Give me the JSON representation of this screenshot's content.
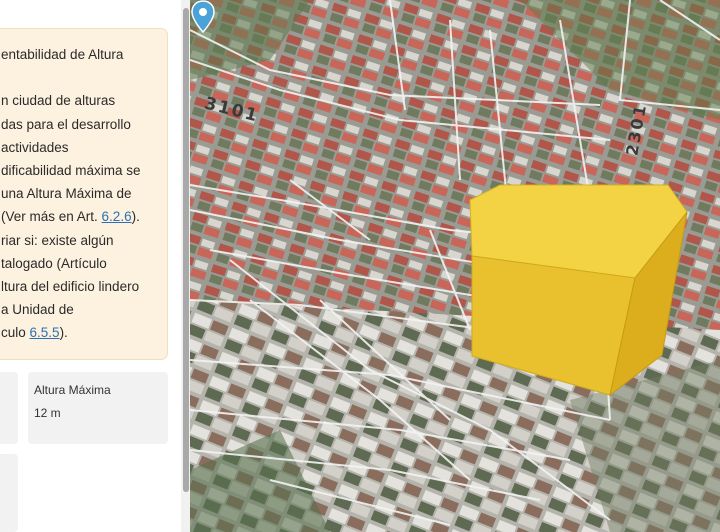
{
  "panel": {
    "card_lines": [
      "entabilidad de Altura",
      "",
      "n ciudad de alturas",
      "das para el desarrollo",
      " actividades",
      "dificabilidad máxima se",
      "una Altura Máxima de",
      {
        "text": "(Ver más en Art. ",
        "link": "6.2.6",
        "after": ")."
      },
      "riar si: existe algún",
      "talogado (Artículo",
      "ltura del edificio lindero",
      "a Unidad de",
      {
        "text": "culo ",
        "link": "6.5.5",
        "after": ")."
      }
    ],
    "stat": {
      "label": "Altura Máxima",
      "value": "12 m"
    }
  },
  "map": {
    "street_labels": [
      "3101",
      "2301"
    ],
    "building_color": "#f4d24a",
    "pin_color": "#4aa3d8"
  }
}
